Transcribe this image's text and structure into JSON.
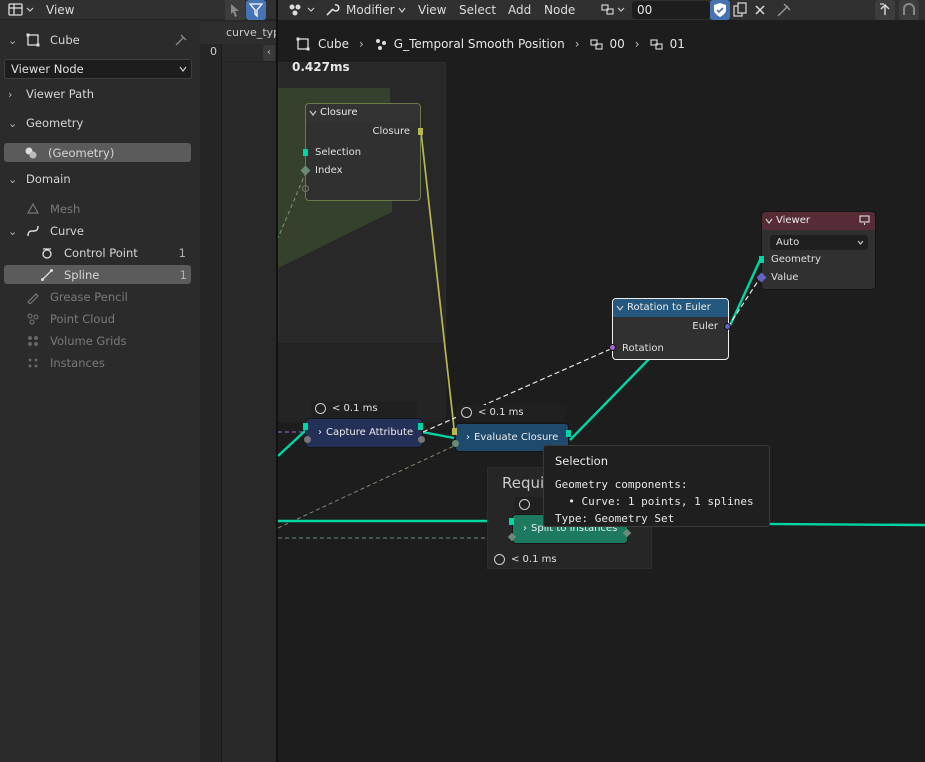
{
  "left_panel": {
    "header_view": "View",
    "object_name": "Cube",
    "viewer_node_select": "Viewer Node",
    "viewer_path": "Viewer Path",
    "geometry_section": "Geometry",
    "geometry_item": "(Geometry)",
    "domain_section": "Domain",
    "domains": [
      {
        "label": "Mesh",
        "count": ""
      },
      {
        "label": "Curve",
        "count": ""
      },
      {
        "label": "Control Point",
        "count": "1"
      },
      {
        "label": "Spline",
        "count": "1"
      },
      {
        "label": "Grease Pencil",
        "count": ""
      },
      {
        "label": "Point Cloud",
        "count": ""
      },
      {
        "label": "Volume Grids",
        "count": ""
      },
      {
        "label": "Instances",
        "count": ""
      }
    ],
    "grid_column_header": "curve_typ",
    "grid_row_index": "0"
  },
  "editor_header": {
    "mode": "Modifier",
    "menus": [
      "View",
      "Select",
      "Add",
      "Node"
    ],
    "nodetree_name": "00"
  },
  "breadcrumbs": [
    "Cube",
    "G_Temporal Smooth Position",
    "00",
    "01"
  ],
  "timing_top": "0.427ms",
  "nodes": {
    "closure": {
      "title": "Closure",
      "outputs": [
        "Closure"
      ],
      "inputs": [
        "Selection",
        "Index"
      ]
    },
    "viewer": {
      "title": "Viewer",
      "mode": "Auto",
      "inputs": [
        "Geometry",
        "Value"
      ]
    },
    "rotation_to_euler": {
      "title": "Rotation to Euler",
      "output": "Euler",
      "input": "Rotation"
    },
    "capture_attribute": {
      "title": "Capture Attribute",
      "timing": "< 0.1 ms"
    },
    "evaluate_closure": {
      "title": "Evaluate Closure",
      "timing": "< 0.1 ms"
    },
    "split_to_instances": {
      "title": "Split to Instances",
      "timing": "< 0.1 ms",
      "frame_label": "Requi"
    }
  },
  "tooltip": {
    "title": "Selection",
    "lines": [
      "Geometry components:",
      "  • Curve: 1 points, 1 splines",
      "Type: Geometry Set"
    ]
  },
  "colors": {
    "geometry_link": "#00d6a3",
    "rotation_socket": "#a365d6",
    "vector_socket": "#6363c7",
    "closure_link": "#b8b852",
    "viewer_header": "#582c37",
    "rotation_header": "#24587f",
    "evaluate_header": "#1e4a6e",
    "capture_header": "#233057",
    "split_header": "#1d7a60"
  }
}
